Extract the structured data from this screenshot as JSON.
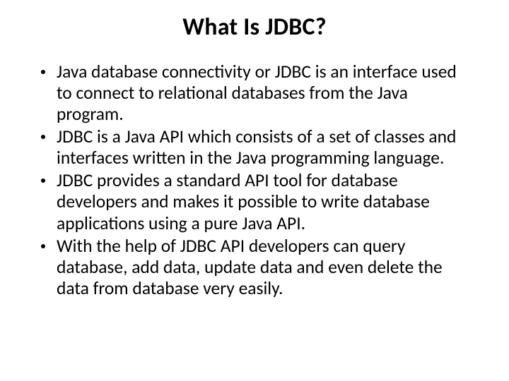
{
  "title": "What Is JDBC?",
  "bullets": [
    "Java database connectivity or JDBC is an interface used to connect to relational databases from the Java program.",
    "JDBC is a Java API which consists of a set of classes and interfaces written in the Java programming language.",
    "JDBC provides a standard API tool for database developers and makes it possible to write database applications using a pure Java API.",
    "With the help of JDBC API developers can query database, add data, update data and even delete the data from database very easily."
  ]
}
